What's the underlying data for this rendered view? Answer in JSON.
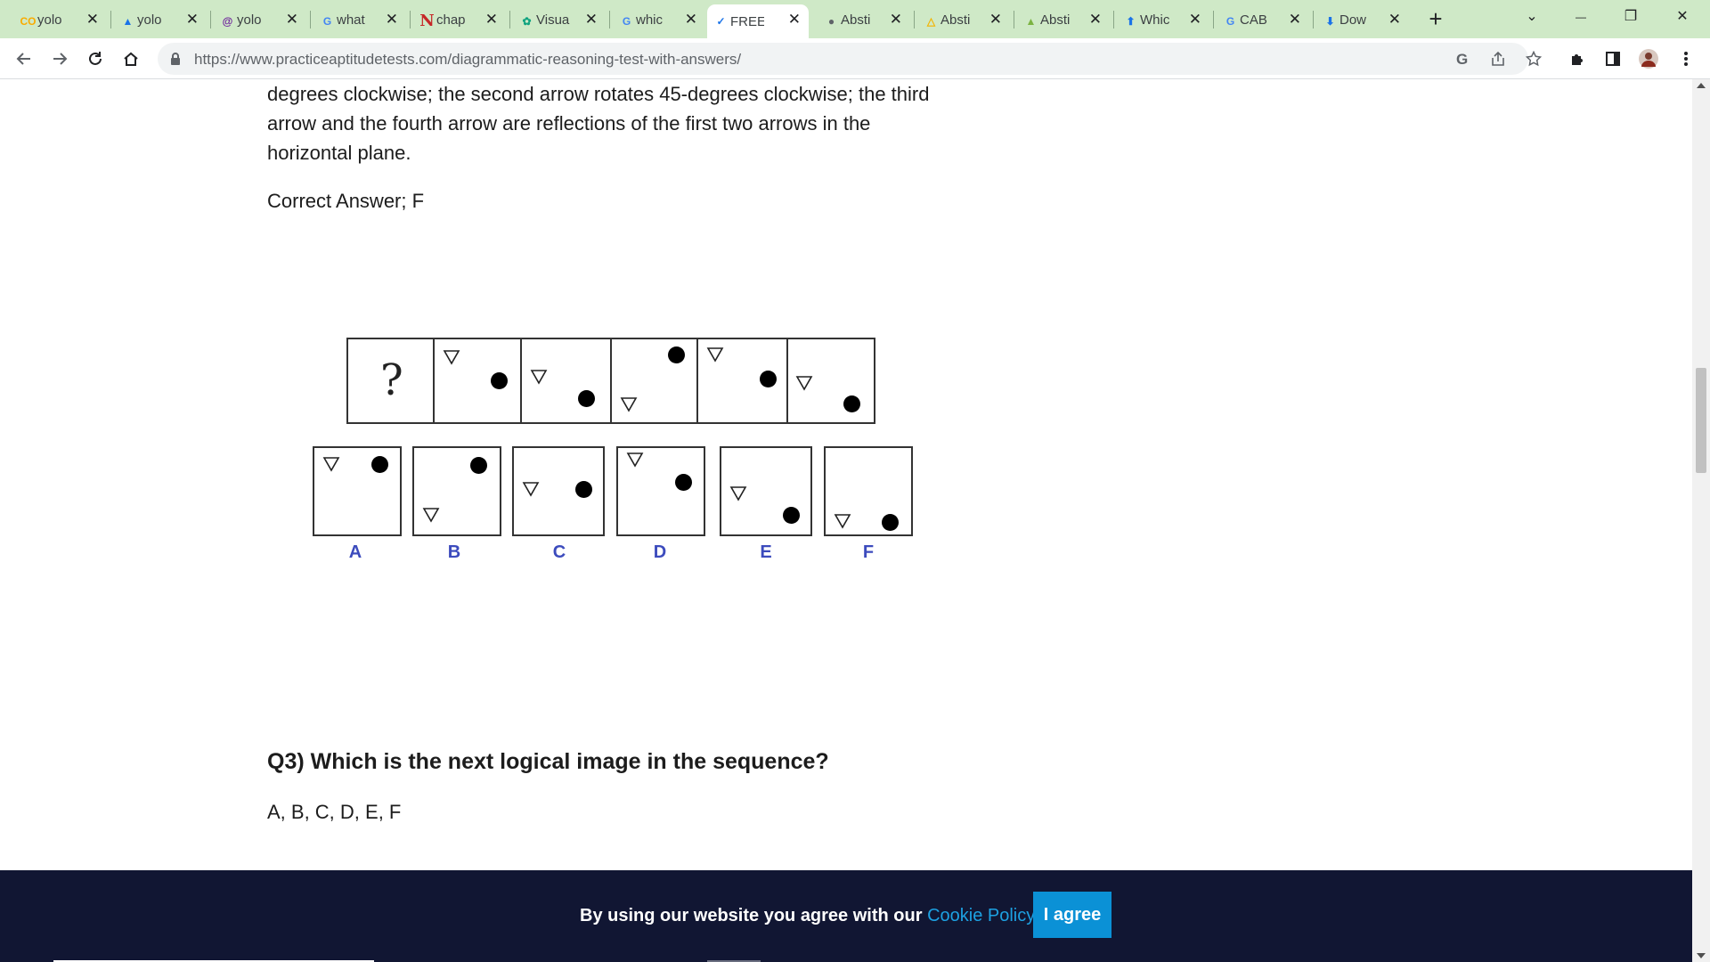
{
  "browser": {
    "tabs": [
      {
        "title": "yolo",
        "icon": "colab-icon",
        "color": "#f9ab00"
      },
      {
        "title": "yolo",
        "icon": "drive-icon",
        "color": "#1a73e8"
      },
      {
        "title": "yolo",
        "icon": "swirl-icon",
        "color": "#6a1b9a"
      },
      {
        "title": "what",
        "icon": "google-icon",
        "color": "#4285f4"
      },
      {
        "title": "chap",
        "icon": "n-icon",
        "color": "#c62828"
      },
      {
        "title": "Visua",
        "icon": "openai-icon",
        "color": "#10a37f"
      },
      {
        "title": "whic",
        "icon": "google-icon",
        "color": "#4285f4"
      },
      {
        "title": "FREE",
        "icon": "check-icon",
        "color": "#1a73e8"
      },
      {
        "title": "Absti",
        "icon": "globe-icon",
        "color": "#5f6368"
      },
      {
        "title": "Absti",
        "icon": "triangle-icon",
        "color": "#f4b400"
      },
      {
        "title": "Absti",
        "icon": "pear-icon",
        "color": "#7cb342"
      },
      {
        "title": "Whic",
        "icon": "upload-icon",
        "color": "#1a73e8"
      },
      {
        "title": "CAB",
        "icon": "google-icon",
        "color": "#4285f4"
      },
      {
        "title": "Dow",
        "icon": "download-icon",
        "color": "#1a73e8"
      }
    ],
    "url": "https://www.practiceaptitudetests.com/diagrammatic-reasoning-test-with-answers/"
  },
  "page": {
    "explanation_lines": [
      "degrees clockwise; the second arrow rotates 45-degrees clockwise; the third",
      "arrow and the fourth arrow are reflections of the first two arrows in the",
      "horizontal plane."
    ],
    "correct_answer": "Correct Answer; F",
    "question_mark": "?",
    "options": [
      "A",
      "B",
      "C",
      "D",
      "E",
      "F"
    ],
    "q3_heading": "Q3) Which is the next logical image in the sequence?",
    "q3_options": "A, B, C, D, E, F"
  },
  "cookie": {
    "text": "By using our website you agree with our ",
    "link": "Cookie Policy.",
    "button": "I agree"
  }
}
